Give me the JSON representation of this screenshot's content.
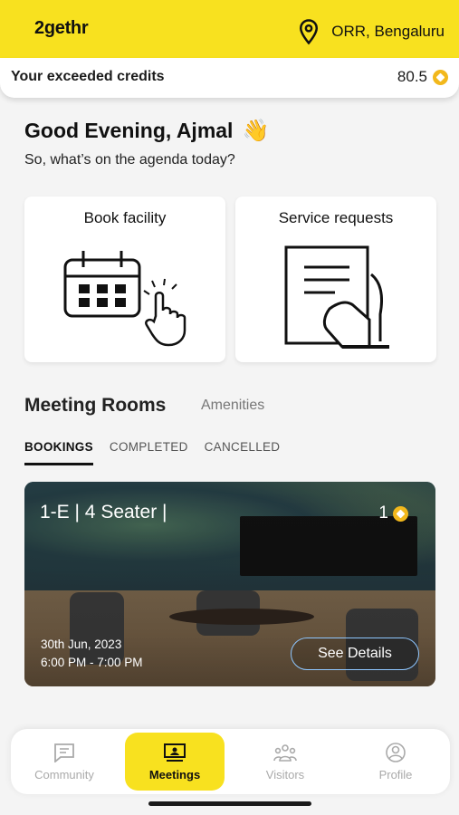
{
  "header": {
    "logo": "2gethr",
    "location": "ORR, Bengaluru",
    "icons": {
      "location": "location-pin-icon"
    },
    "accent_color": "#f8e11f"
  },
  "credits": {
    "label": "Your exceeded credits",
    "value": "80.5",
    "icon": "credit-coin-icon"
  },
  "greeting": {
    "title": "Good Evening, Ajmal",
    "emoji": "👋",
    "subtitle": "So, what’s on the agenda today?"
  },
  "quick_actions": [
    {
      "label": "Book facility",
      "icon": "calendar-tap-icon"
    },
    {
      "label": "Service requests",
      "icon": "document-hand-icon"
    }
  ],
  "section": {
    "title": "Meeting Rooms",
    "secondary": "Amenities",
    "tabs": [
      "BOOKINGS",
      "COMPLETED",
      "CANCELLED"
    ],
    "active_tab": "BOOKINGS"
  },
  "booking": {
    "room": "1-E | 4 Seater |",
    "credits": "1",
    "date": "30th Jun, 2023",
    "time": "6:00 PM - 7:00 PM",
    "action": "See Details"
  },
  "bottom_nav": [
    {
      "label": "Community",
      "icon": "chat-icon",
      "active": false
    },
    {
      "label": "Meetings",
      "icon": "meeting-screen-icon",
      "active": true
    },
    {
      "label": "Visitors",
      "icon": "people-icon",
      "active": false
    },
    {
      "label": "Profile",
      "icon": "profile-icon",
      "active": false
    }
  ]
}
